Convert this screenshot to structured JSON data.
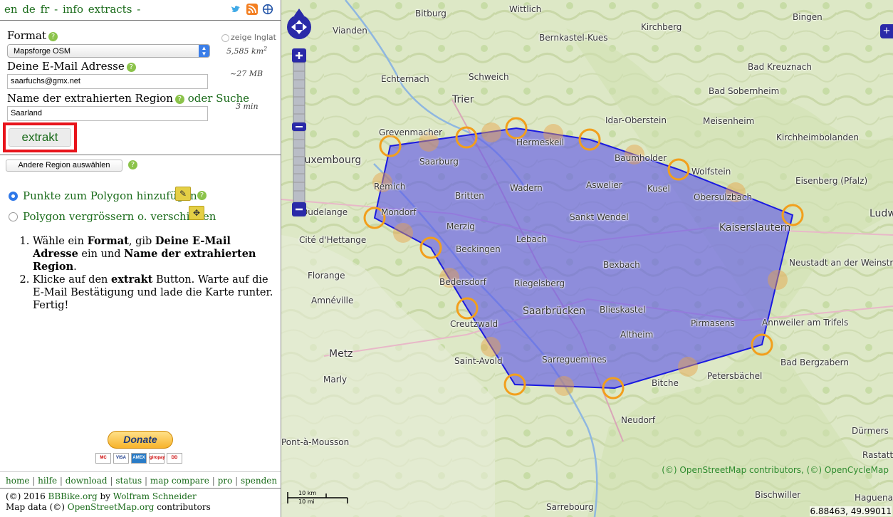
{
  "header": {
    "lang_en": "en",
    "lang_de": "de",
    "lang_fr": "fr",
    "sep": "-",
    "info": "info",
    "extracts": "extracts",
    "trail": "-"
  },
  "form": {
    "format_label": "Format",
    "format_value": "Mapsforge OSM",
    "email_label": "Deine E-Mail Adresse",
    "email_value": "saarfuchs@gmx.net",
    "region_label": "Name der extrahierten Region",
    "or_search": "oder Suche",
    "region_value": "Saarland",
    "extrakt_label": "extrakt",
    "show_lnglat": "zeige lnglat",
    "area": "5,585 km",
    "area_sup": "2",
    "size": "~27 MB",
    "time": "3 min",
    "help_glyph": "?"
  },
  "controls": {
    "other_region": "Andere Region auswählen",
    "add_points": "Punkte zum Polygon hinzufügen",
    "move_polygon": "Polygon vergrössern o. verschieben"
  },
  "instructions": {
    "step1": [
      "Wähle ein ",
      "Format",
      ", gib ",
      "Deine E-Mail Adresse",
      " ein und ",
      "Name der extrahierten Region",
      "."
    ],
    "step2": [
      "Klicke auf den ",
      "extrakt",
      " Button. Warte auf die E-Mail Bestätigung und lade die Karte runter. Fertig!"
    ]
  },
  "donate": {
    "label": "Donate",
    "cards": [
      "MC",
      "VISA",
      "AMEX",
      "giropay",
      "DD"
    ]
  },
  "footer": {
    "nav": [
      "home",
      "hilfe",
      "download",
      "status",
      "map compare",
      "pro",
      "spenden"
    ],
    "copy_prefix": "(©) 2016 ",
    "copy_site": "BBBike.org",
    "copy_by": " by ",
    "copy_author": "Wolfram Schneider",
    "mapdata_prefix": "Map data (©) ",
    "mapdata_site": "OpenStreetMap.org",
    "mapdata_suffix": " contributors"
  },
  "map": {
    "attribution": "(©) OpenStreetMap contributors, (©) OpenCycleMap",
    "coords": "6.88463, 49.99011",
    "scale_km": "10 km",
    "scale_mi": "10 mi",
    "towns": [
      {
        "name": "Bitburg"
      },
      {
        "name": "Wittlich"
      },
      {
        "name": "Kirchberg"
      },
      {
        "name": "Bingen"
      },
      {
        "name": "Vianden"
      },
      {
        "name": "Bernkastel-Kues"
      },
      {
        "name": "Echternach"
      },
      {
        "name": "Schweich"
      },
      {
        "name": "Bad Kreuznach"
      },
      {
        "name": "Trier"
      },
      {
        "name": "Bad Sobernheim"
      },
      {
        "name": "Idar-Oberstein"
      },
      {
        "name": "Meisenheim"
      },
      {
        "name": "Grevenmacher"
      },
      {
        "name": "Hermeskeil"
      },
      {
        "name": "Kirchheimbolanden"
      },
      {
        "name": "Luxembourg"
      },
      {
        "name": "Saarburg"
      },
      {
        "name": "Baumholder"
      },
      {
        "name": "Wolfstein"
      },
      {
        "name": "Eisenberg (Pfalz)"
      },
      {
        "name": "Remich"
      },
      {
        "name": "Wadern"
      },
      {
        "name": "Aswelier"
      },
      {
        "name": "Kusel"
      },
      {
        "name": "Obersulzbach"
      },
      {
        "name": "Britten"
      },
      {
        "name": "Dudelange"
      },
      {
        "name": "Mondorf"
      },
      {
        "name": "Ludw"
      },
      {
        "name": "Sankt Wendel"
      },
      {
        "name": "Kaiserslautern"
      },
      {
        "name": "Merzig"
      },
      {
        "name": "Cité d'Hettange"
      },
      {
        "name": "Lebach"
      },
      {
        "name": "Beckingen"
      },
      {
        "name": "Neustadt an der Weinstr"
      },
      {
        "name": "Bexbach"
      },
      {
        "name": "Florange"
      },
      {
        "name": "Bedersdorf"
      },
      {
        "name": "Riegelsberg"
      },
      {
        "name": "Amnéville"
      },
      {
        "name": "Saarbrücken"
      },
      {
        "name": "Blieskastel"
      },
      {
        "name": "Creutzwald"
      },
      {
        "name": "Pirmasens"
      },
      {
        "name": "Annweiler am Trifels"
      },
      {
        "name": "Altheim"
      },
      {
        "name": "Metz"
      },
      {
        "name": "Saint-Avold"
      },
      {
        "name": "Bad Bergzabern"
      },
      {
        "name": "Sarreguemines"
      },
      {
        "name": "Marly"
      },
      {
        "name": "Petersbächel"
      },
      {
        "name": "Bitche"
      },
      {
        "name": "Neudorf"
      },
      {
        "name": "Pont-à-Mousson"
      },
      {
        "name": "Rastatt"
      },
      {
        "name": "Dürmers"
      },
      {
        "name": "Bischwiller"
      },
      {
        "name": "Sarrebourg"
      },
      {
        "name": "Haguenau"
      }
    ]
  },
  "colors": {
    "link": "#1a6b1a",
    "highlight": "#e8141b",
    "polygon_fill": "#5d55e8",
    "polygon_stroke": "#1a1ae0",
    "vertex": "#f29f1c",
    "pan_control": "#2a2aa8"
  }
}
